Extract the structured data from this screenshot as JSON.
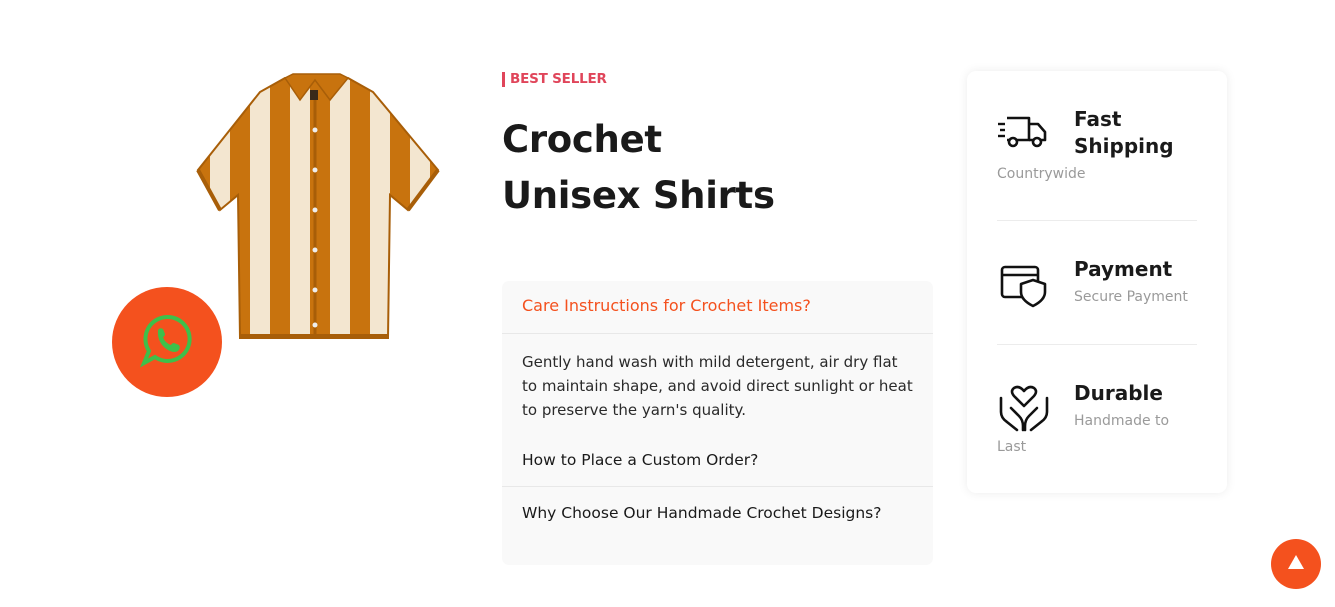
{
  "badge": "BEST SELLER",
  "product": {
    "title_line1": "Crochet",
    "title_line2": "Unisex Shirts",
    "image_icon": "striped-crochet-shirt"
  },
  "faq": {
    "items": [
      {
        "question": "Care Instructions for Crochet Items?",
        "answer": "Gently hand wash with mild detergent, air dry flat to maintain shape, and avoid direct sunlight or heat to preserve the yarn's quality.",
        "open": true
      },
      {
        "question": "How to Place a Custom Order?",
        "open": false
      },
      {
        "question": "Why Choose Our Handmade Crochet Designs?",
        "open": false
      }
    ]
  },
  "features": [
    {
      "title_line1": "Fast",
      "title_line2": "Shipping",
      "subtitle": "Countrywide",
      "icon": "truck-icon"
    },
    {
      "title": "Payment",
      "subtitle": "Secure Payment",
      "icon": "card-shield-icon"
    },
    {
      "title": "Durable",
      "subtitle_line1": "Handmade to",
      "subtitle_line2": "Last",
      "icon": "hands-heart-icon"
    }
  ],
  "colors": {
    "accent": "#f4511e",
    "badge": "#e0455a",
    "shirt_stripe": "#c8730e",
    "shirt_cream": "#f3e6d0",
    "whatsapp_green": "#3ec04a"
  },
  "floating": {
    "whatsapp_icon": "whatsapp-icon",
    "scroll_top_icon": "arrow-up-icon"
  }
}
